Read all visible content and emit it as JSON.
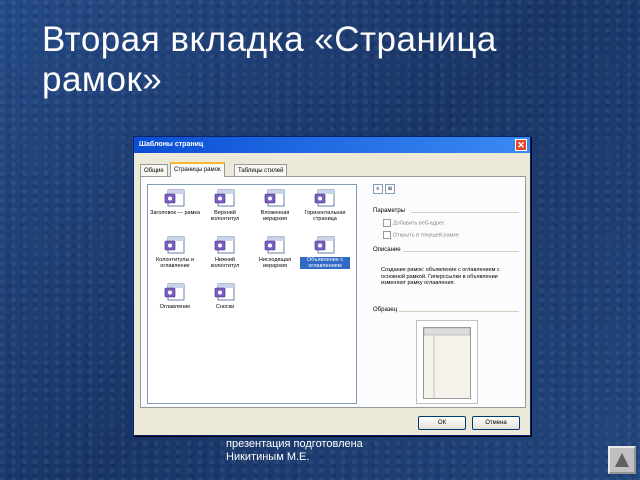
{
  "slide": {
    "title": "Вторая  вкладка «Страница рамок»",
    "footer_line1": "презентация подготовлена",
    "footer_line2": "Никитиным М.Е."
  },
  "dialog": {
    "title": "Шаблоны страниц",
    "close_glyph": "✕",
    "tabs": [
      "Общие",
      "Страницы рамок",
      "Таблицы стилей"
    ],
    "active_tab": 1,
    "items": [
      "Заголовок — рамка",
      "Верхний колонтитул",
      "Вложенная иерархия",
      "Горизонтальная страница",
      "Колонтитулы и оглавление",
      "Нижний колонтитул",
      "Нисходящая иерархия",
      "Объявление с оглавлением",
      "Оглавление",
      "Сноски"
    ],
    "selected_item": 7,
    "view_buttons": [
      "≡",
      "⊞"
    ],
    "options_label": "Параметры",
    "options": [
      "Добавить веб-адрес",
      "Открыть в текущей рамке"
    ],
    "description_label": "Описание",
    "description": "Создание рамок: объявление с оглавлением с основной рамкой. Гиперссылки в объявлении изменяют рамку оглавления.",
    "preview_label": "Образец",
    "ok_label": "ОК",
    "cancel_label": "Отмена"
  },
  "colors": {
    "background": "#1d3e73",
    "titlebar": "#0a4fd4",
    "selection": "#316ac5"
  }
}
